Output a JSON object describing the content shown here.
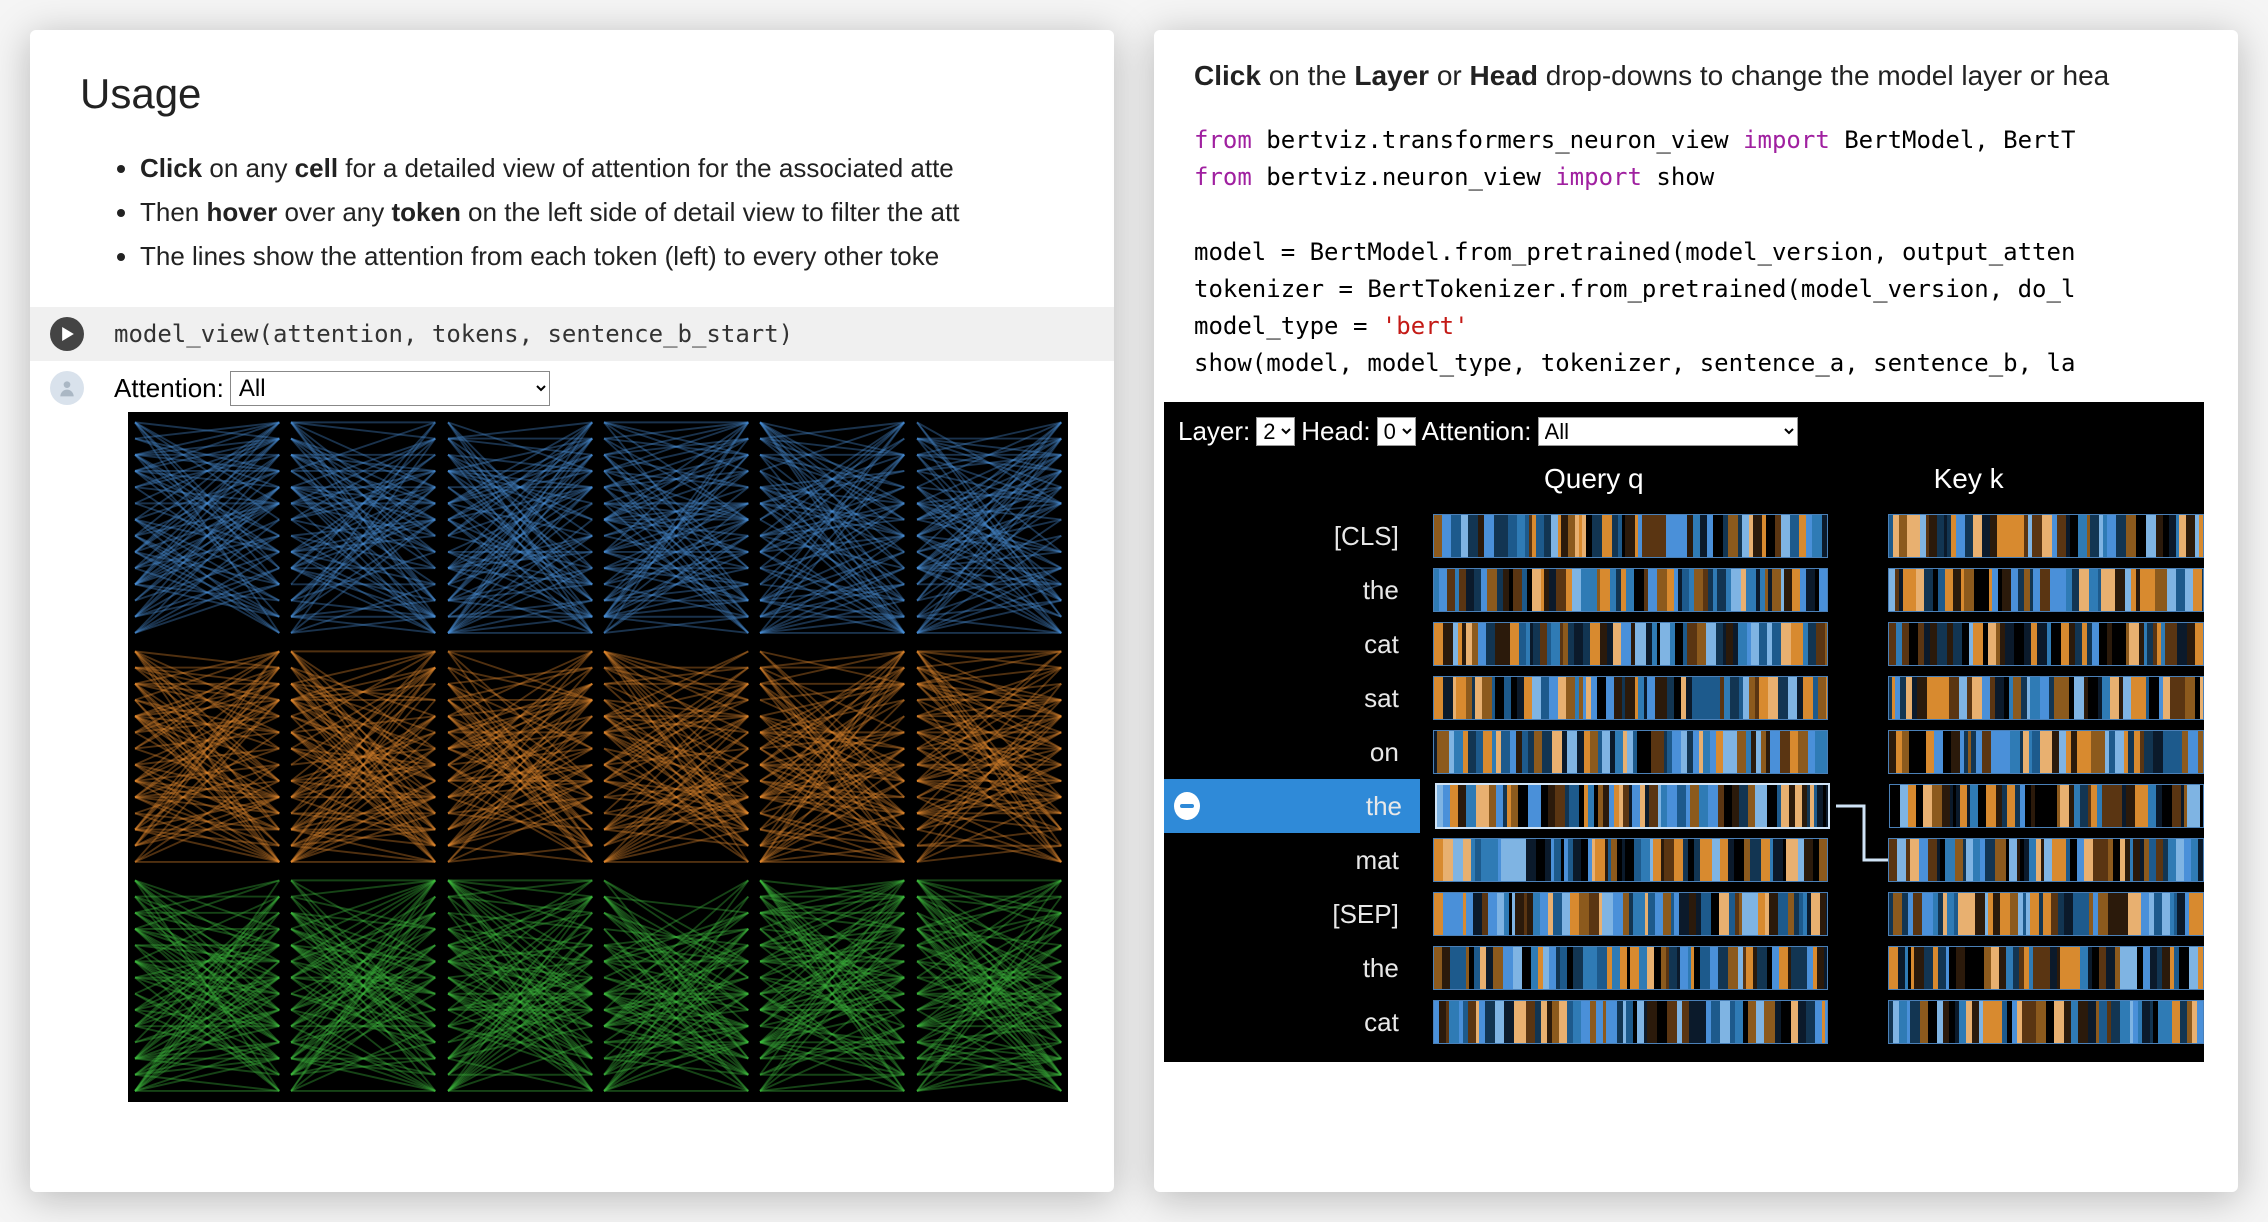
{
  "left": {
    "heading": "Usage",
    "bullets": [
      {
        "pre": "",
        "b1": "Click",
        "mid1": " on any ",
        "b2": "cell",
        "mid2": " for a detailed view of attention for the associated atte"
      },
      {
        "pre": "Then ",
        "b1": "hover",
        "mid1": " over any ",
        "b2": "token",
        "mid2": " on the left side of detail view to filter the att"
      },
      {
        "pre": "",
        "b1": "",
        "mid1": "The lines show the attention from each token (left) to every other toke",
        "b2": "",
        "mid2": ""
      }
    ],
    "code_line": "model_view(attention, tokens, sentence_b_start)",
    "attention_label": "Attention:",
    "attention_value": "All",
    "grid": {
      "rows": 3,
      "cols": 6,
      "row_colors": [
        "#4a90d9",
        "#e58a2e",
        "#3fbf3f"
      ]
    }
  },
  "right": {
    "instruction": {
      "b1": "Click",
      "t1": " on the ",
      "b2": "Layer",
      "t2": " or ",
      "b3": "Head",
      "t3": " drop-downs to change the model layer or hea"
    },
    "code": [
      {
        "type": "from",
        "mod": "bertviz.transformers_neuron_view",
        "imports": "BertModel, BertT"
      },
      {
        "type": "from",
        "mod": "bertviz.neuron_view",
        "imports": "show"
      },
      {
        "type": "blank"
      },
      {
        "type": "plain",
        "text": "model = BertModel.from_pretrained(model_version, output_atten"
      },
      {
        "type": "plain",
        "text": "tokenizer = BertTokenizer.from_pretrained(model_version, do_l"
      },
      {
        "type": "assign",
        "lhs": "model_type = ",
        "str": "'bert'"
      },
      {
        "type": "plain",
        "text": "show(model, model_type, tokenizer, sentence_a, sentence_b, la"
      }
    ],
    "nv": {
      "layer_label": "Layer:",
      "layer_value": "2",
      "head_label": "Head:",
      "head_value": "0",
      "attention_label": "Attention:",
      "attention_value": "All",
      "header_q": "Query q",
      "header_k": "Key k",
      "tokens": [
        "[CLS]",
        "the",
        "cat",
        "sat",
        "on",
        "the",
        "mat",
        "[SEP]",
        "the",
        "cat"
      ],
      "selected_index": 5,
      "stripe_palette": [
        "#0b1a2b",
        "#123552",
        "#1d5a8c",
        "#2f7bb5",
        "#4a90d9",
        "#7fb4e3",
        "#2b1a0b",
        "#5a3512",
        "#8c5a1d",
        "#d88a2f",
        "#e8b070",
        "#000000"
      ]
    }
  }
}
